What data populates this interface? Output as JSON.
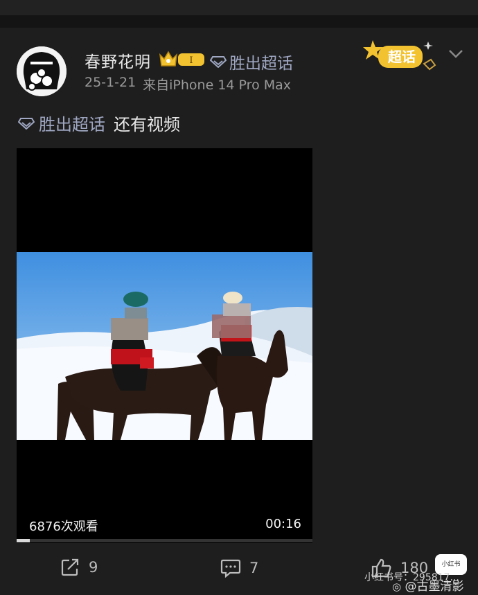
{
  "post": {
    "username": "春野花明",
    "level_badge": "I",
    "topic_tag": "胜出超话",
    "date": "25-1-21",
    "source": "来自iPhone 14 Pro Max",
    "super_badge_label": "超话",
    "body_tag": "胜出超话",
    "body_text": "还有视频"
  },
  "video": {
    "views": "6876次观看",
    "duration": "00:16",
    "progress_fraction": 0.045
  },
  "actions": {
    "repost_count": "9",
    "comment_count": "7",
    "like_count": "180"
  },
  "watermark": {
    "line1": "小红书号：295817...",
    "line2": "@古墨清影",
    "logo": "小红书"
  },
  "colors": {
    "background": "#1e1e1e",
    "tag_blue": "#9fa7c2",
    "crown_gold": "#f2c230"
  },
  "icons": [
    "avatar",
    "crown-icon",
    "diamond-icon",
    "chevron-down-icon",
    "repost-icon",
    "comment-icon",
    "like-icon",
    "weibo-icon"
  ]
}
